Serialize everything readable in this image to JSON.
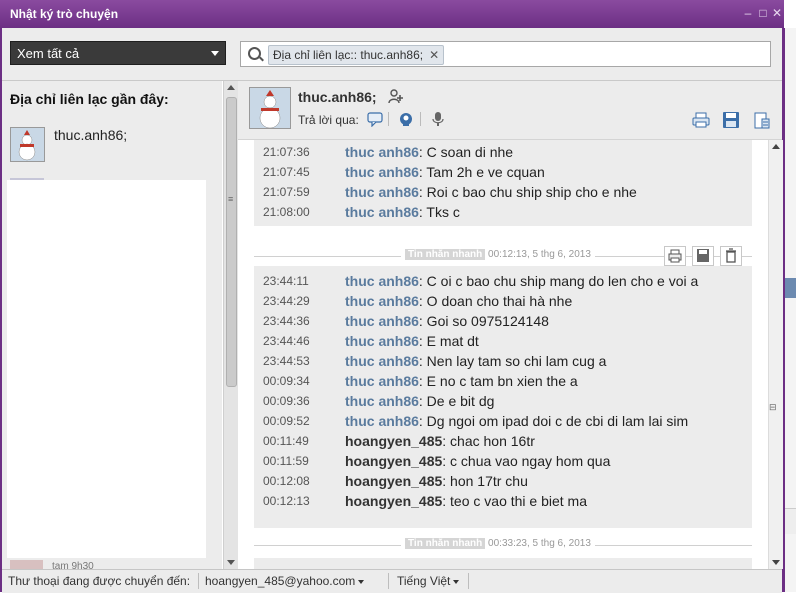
{
  "window": {
    "title": "Nhật ký trò chuyện"
  },
  "toolbar": {
    "filter_label": "Xem tất cả",
    "search_token": "Địa chỉ liên lạc:: thuc.anh86;",
    "token_close": "✕"
  },
  "sidebar": {
    "title": "Địa chỉ liên lạc gần đây:",
    "contacts": [
      {
        "name": "thuc.anh86;"
      }
    ],
    "bottom_partial": "tam 9h30"
  },
  "conversation": {
    "contact_name": "thuc.anh86;",
    "reply_via_label": "Trả lời qua:",
    "blocks": [
      {
        "messages": [
          {
            "time": "21:07:36",
            "sender": "thuc anh86",
            "text": ": C soan di nhe"
          },
          {
            "time": "21:07:45",
            "sender": "thuc anh86",
            "text": ": Tam 2h e ve cquan"
          },
          {
            "time": "21:07:59",
            "sender": "thuc anh86",
            "text": ": Roi c bao chu ship ship cho e nhe"
          },
          {
            "time": "21:08:00",
            "sender": "thuc anh86",
            "text": ": Tks c"
          }
        ]
      },
      {
        "type_label": "Tin nhắn nhanh",
        "timestamp": "00:12:13, 5 thg 6, 2013",
        "messages": [
          {
            "time": "23:44:11",
            "sender": "thuc anh86",
            "text": ": C oi c bao chu ship mang do len cho e voi a"
          },
          {
            "time": "23:44:29",
            "sender": "thuc anh86",
            "text": ": O doan cho thai hà nhe"
          },
          {
            "time": "23:44:36",
            "sender": "thuc anh86",
            "text": ": Goi so 0975124148"
          },
          {
            "time": "23:44:46",
            "sender": "thuc anh86",
            "text": ": E mat dt"
          },
          {
            "time": "23:44:53",
            "sender": "thuc anh86",
            "text": ": Nen lay tam so chi lam cug a"
          },
          {
            "time": "00:09:34",
            "sender": "thuc anh86",
            "text": ": E no c tam bn xien the a"
          },
          {
            "time": "00:09:36",
            "sender": "thuc anh86",
            "text": ": De e bit dg"
          },
          {
            "time": "00:09:52",
            "sender": "thuc anh86",
            "text": ": Dg ngoi om ipad doi c de cbi di lam lai sim"
          },
          {
            "time": "00:11:49",
            "sender": "hoangyen_485",
            "text": ": chac hon 16tr"
          },
          {
            "time": "00:11:59",
            "sender": "hoangyen_485",
            "text": ": c chua vao ngay hom qua"
          },
          {
            "time": "00:12:08",
            "sender": "hoangyen_485",
            "text": ": hon 17tr chu"
          },
          {
            "time": "00:12:13",
            "sender": "hoangyen_485",
            "text": ": teo c vao thi e biet ma"
          }
        ]
      },
      {
        "type_label": "Tin nhắn nhanh",
        "timestamp": "00:33:23, 5 thg 6, 2013"
      }
    ]
  },
  "statusbar": {
    "forward_label": "Thư thoại đang được chuyển đến:",
    "forward_value": "hoangyen_485@yahoo.com",
    "language": "Tiếng Việt"
  },
  "colors": {
    "titlebar": "#7a3d92",
    "contact_sender": "#5a7b9e",
    "self_sender": "#333333",
    "toolbar_icons": "#3b6ea8"
  }
}
